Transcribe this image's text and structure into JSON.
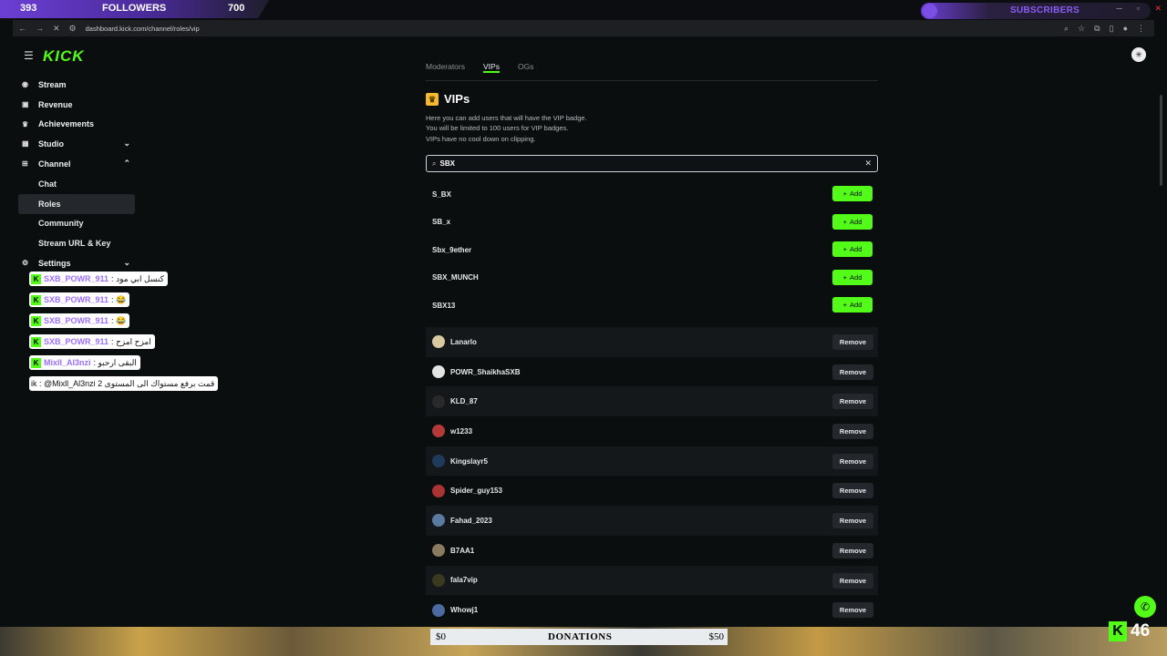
{
  "overlay": {
    "followers_current": "393",
    "followers_label": "FOLLOWERS",
    "followers_goal": "700",
    "subscribers_label": "SUBSCRIBERS"
  },
  "browser": {
    "url": "dashboard.kick.com/channel/roles/vip"
  },
  "sidebar": {
    "logo": "KICK",
    "items": [
      {
        "label": "Stream",
        "icon": "radio-icon"
      },
      {
        "label": "Revenue",
        "icon": "dollar-icon"
      },
      {
        "label": "Achievements",
        "icon": "trophy-icon"
      },
      {
        "label": "Studio",
        "icon": "studio-icon"
      },
      {
        "label": "Channel",
        "icon": "channel-icon"
      }
    ],
    "sub_items": [
      "Chat",
      "Roles",
      "Community",
      "Stream URL & Key"
    ],
    "settings": "Settings"
  },
  "chat": [
    {
      "name": "SXB_POWR_911",
      "text": ": كنسل ابي مود"
    },
    {
      "name": "SXB_POWR_911",
      "text": ": 😂"
    },
    {
      "name": "SXB_POWR_911",
      "text": ": 😂"
    },
    {
      "name": "SXB_POWR_911",
      "text": ": امزح امزح"
    },
    {
      "name": "Mixll_Al3nzi",
      "text": ": البقى ارحبو"
    },
    {
      "name": "",
      "text": "ik : @Mixll_Al3nzi قمت برفع مستواك الى المستوى 2"
    }
  ],
  "main": {
    "tabs": [
      "Moderators",
      "VIPs",
      "OGs"
    ],
    "title": "VIPs",
    "desc1": "Here you can add users that will have the VIP badge.",
    "desc2": "You will be limited to 100 users for VIP badges.",
    "desc3": "VIPs have no cool down on clipping.",
    "search_value": "SBX",
    "add_label": "Add",
    "remove_label": "Remove",
    "results": [
      "S_BX",
      "SB_x",
      "Sbx_9ether",
      "SBX_MUNCH",
      "SBX13"
    ],
    "vips": [
      {
        "name": "Lanarlo",
        "color": "#d8c9a0"
      },
      {
        "name": "POWR_ShaikhaSXB",
        "color": "#e3e3e3"
      },
      {
        "name": "KLD_87",
        "color": "#2a2a2a"
      },
      {
        "name": "w1233",
        "color": "#b43a3a"
      },
      {
        "name": "Kingslayr5",
        "color": "#1f3a5a"
      },
      {
        "name": "Spider_guy153",
        "color": "#a33"
      },
      {
        "name": "Fahad_2023",
        "color": "#5a7aa0"
      },
      {
        "name": "B7AA1",
        "color": "#8a7a60"
      },
      {
        "name": "fala7vip",
        "color": "#3a3a20"
      },
      {
        "name": "Whowj1",
        "color": "#4a6aa0"
      }
    ]
  },
  "bottom": {
    "donation_min": "$0",
    "donations_label": "DONATIONS",
    "donation_max": "$50",
    "viewer_count": "46"
  }
}
